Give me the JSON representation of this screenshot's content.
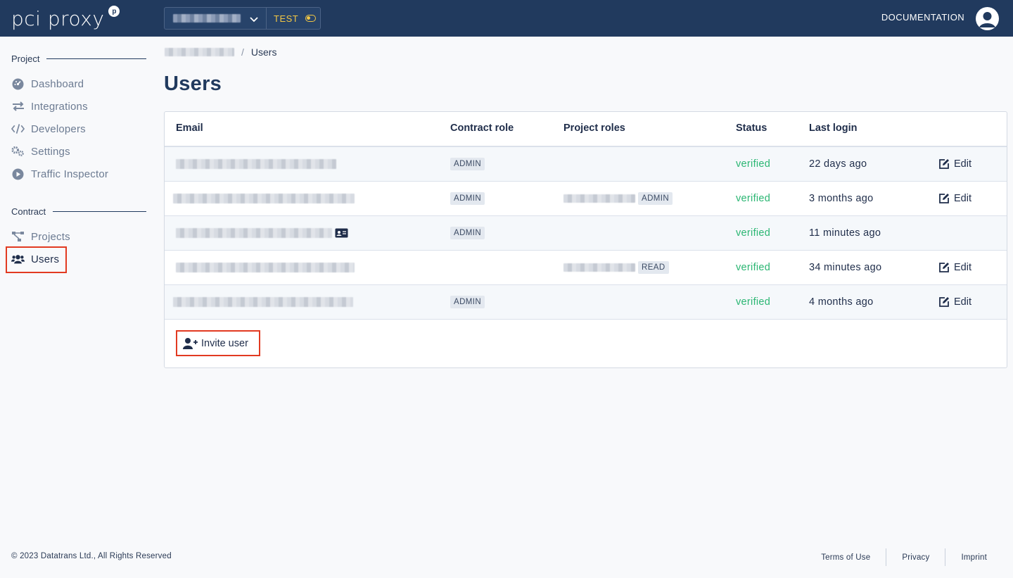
{
  "header": {
    "logo_text": "pci proxy",
    "logo_mark": "p",
    "environment": "TEST",
    "documentation_label": "DOCUMENTATION",
    "account_icon": "user-circle-icon"
  },
  "breadcrumb": {
    "current": "Users",
    "separator": "/"
  },
  "sidebar": {
    "project_section": "Project",
    "project_items": [
      {
        "label": "Dashboard",
        "icon": "dashboard-icon"
      },
      {
        "label": "Integrations",
        "icon": "arrows-exchange-icon"
      },
      {
        "label": "Developers",
        "icon": "code-icon"
      },
      {
        "label": "Settings",
        "icon": "gears-icon"
      },
      {
        "label": "Traffic Inspector",
        "icon": "play-circle-icon"
      }
    ],
    "contract_section": "Contract",
    "contract_items": [
      {
        "label": "Projects",
        "icon": "sitemap-icon"
      },
      {
        "label": "Users",
        "icon": "users-icon",
        "active": true
      }
    ]
  },
  "main": {
    "title": "Users",
    "table": {
      "columns": [
        "Email",
        "Contract role",
        "Project roles",
        "Status",
        "Last login"
      ],
      "rows": [
        {
          "contract_role": "ADMIN",
          "project_role": "",
          "status": "verified",
          "last_login": "22 days ago",
          "edit": "Edit"
        },
        {
          "contract_role": "ADMIN",
          "project_role": "ADMIN",
          "status": "verified",
          "last_login": "3 months ago",
          "edit": "Edit"
        },
        {
          "contract_role": "ADMIN",
          "project_role": "",
          "status": "verified",
          "last_login": "11 minutes ago",
          "edit": ""
        },
        {
          "contract_role": "",
          "project_role": "READ",
          "status": "verified",
          "last_login": "34 minutes ago",
          "edit": "Edit"
        },
        {
          "contract_role": "ADMIN",
          "project_role": "",
          "status": "verified",
          "last_login": "4 months ago",
          "edit": "Edit"
        }
      ]
    },
    "invite_label": "Invite user"
  },
  "footer": {
    "copyright": "© 2023 Datatrans Ltd., All Rights Reserved",
    "links": [
      "Terms of Use",
      "Privacy",
      "Imprint"
    ]
  },
  "colors": {
    "header_bg": "#213a5e",
    "accent_env": "#f2c744",
    "status_verified": "#2bb673",
    "highlight": "#e23a21"
  }
}
